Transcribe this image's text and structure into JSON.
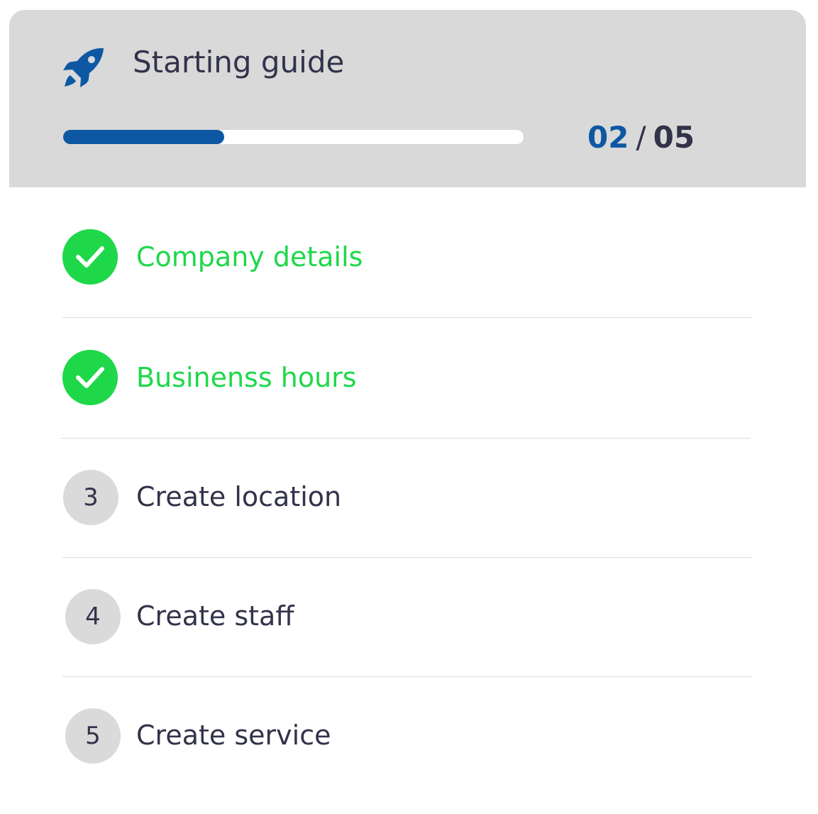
{
  "guide": {
    "title": "Starting guide",
    "icon": "rocket-icon",
    "progress": {
      "current": "02",
      "separator": "/",
      "total": "05",
      "fraction": 0.35
    }
  },
  "colors": {
    "accent": "#0e58a3",
    "done": "#1ed84a",
    "pending_badge": "#dadada",
    "text": "#32334a",
    "header_bg": "#d9d9d9"
  },
  "steps": [
    {
      "number": "1",
      "label": "Company details",
      "status": "done"
    },
    {
      "number": "2",
      "label": "Businenss hours",
      "status": "done"
    },
    {
      "number": "3",
      "label": "Create location",
      "status": "todo"
    },
    {
      "number": "4",
      "label": "Create staff",
      "status": "todo"
    },
    {
      "number": "5",
      "label": "Create service",
      "status": "todo"
    }
  ]
}
